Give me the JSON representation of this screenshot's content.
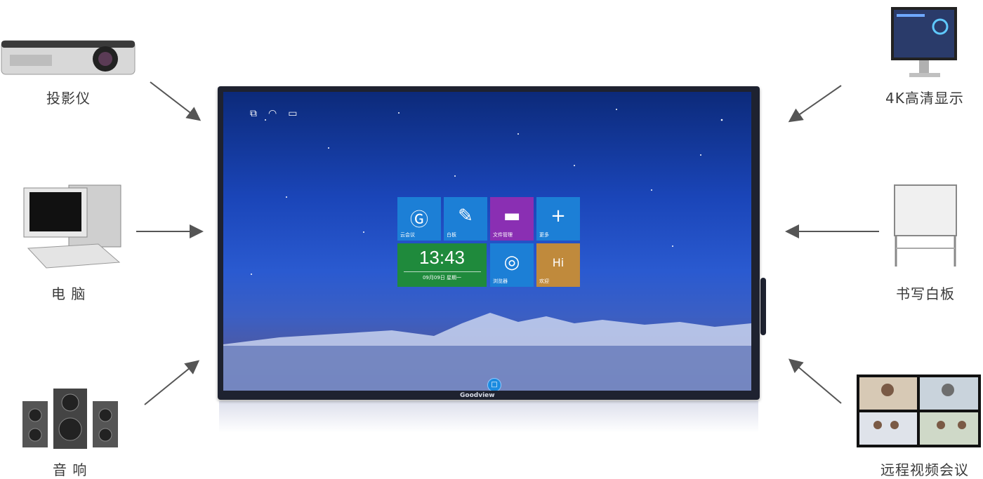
{
  "devices": {
    "projector": {
      "label": "投影仪"
    },
    "computer": {
      "label": "电 脑"
    },
    "speakers": {
      "label": "音 响"
    },
    "monitor": {
      "label": "4K高清显示"
    },
    "whiteboard": {
      "label": "书写白板"
    },
    "video_conference": {
      "label": "远程视频会议"
    }
  },
  "screen": {
    "brand": "Goodview",
    "tiles": [
      {
        "label": "云会议",
        "icon": "cloud-meeting-icon",
        "color": "#1c7fd6"
      },
      {
        "label": "白板",
        "icon": "whiteboard-icon",
        "color": "#1c7fd6"
      },
      {
        "label": "文件管理",
        "icon": "folder-icon",
        "color": "#8a2fb3"
      },
      {
        "label": "更多",
        "icon": "plus-icon",
        "color": "#1c7fd6"
      },
      {
        "label": "浏览器",
        "icon": "chrome-icon",
        "color": "#1c7fd6"
      },
      {
        "label": "欢迎",
        "icon": "hi-icon",
        "color": "#c08a3c"
      }
    ],
    "clock": {
      "time": "13:43",
      "date": "09月09日 星期一",
      "color": "#1f8a3c"
    }
  }
}
